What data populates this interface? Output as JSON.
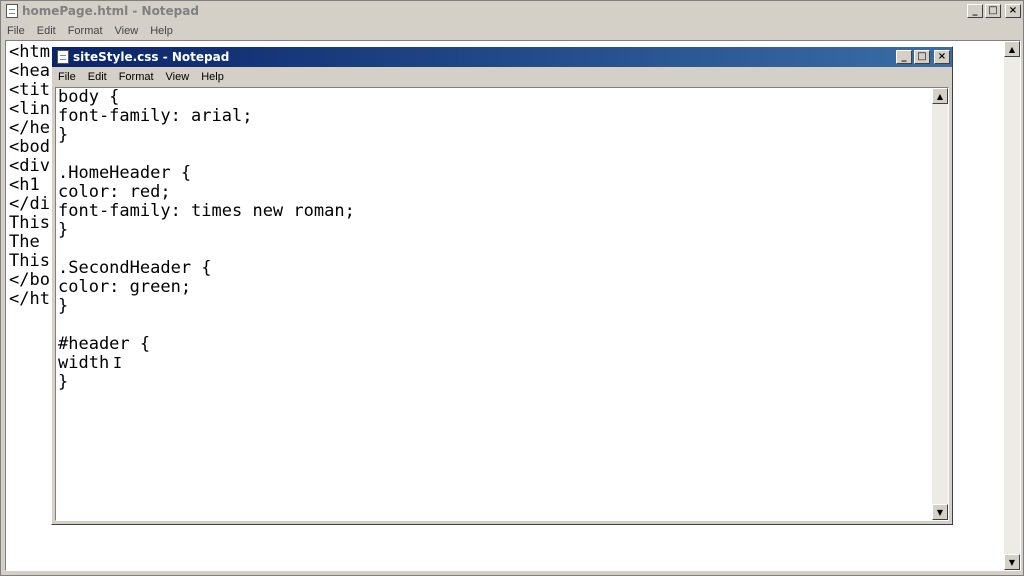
{
  "back_window": {
    "title": "homePage.html - Notepad",
    "menu": [
      "File",
      "Edit",
      "Format",
      "View",
      "Help"
    ],
    "visible_lines": [
      "<htm",
      "<hea",
      "<tit",
      "<lin",
      "</he",
      "<bod",
      "<div",
      "<h1",
      "</di",
      "This",
      "The",
      "This",
      "</bo",
      "</ht"
    ]
  },
  "front_window": {
    "title": "siteStyle.css - Notepad",
    "menu": [
      "File",
      "Edit",
      "Format",
      "View",
      "Help"
    ],
    "code": "body {\nfont-family: arial;\n}\n\n.HomeHeader {\ncolor: red;\nfont-family: times new roman;\n}\n\n.SecondHeader {\ncolor: green;\n}\n\n#header {\nwidth\n}"
  },
  "caption_buttons": {
    "minimize": "_",
    "maximize": "□",
    "close": "×"
  },
  "scroll_arrows": {
    "up": "▲",
    "down": "▼"
  },
  "colors": {
    "active_title_bg": "#0a246a",
    "active_title_text": "#ffffff",
    "inactive_title_bg": "#d4d0c8",
    "inactive_title_text": "#808080",
    "chrome": "#d4d0c8"
  }
}
